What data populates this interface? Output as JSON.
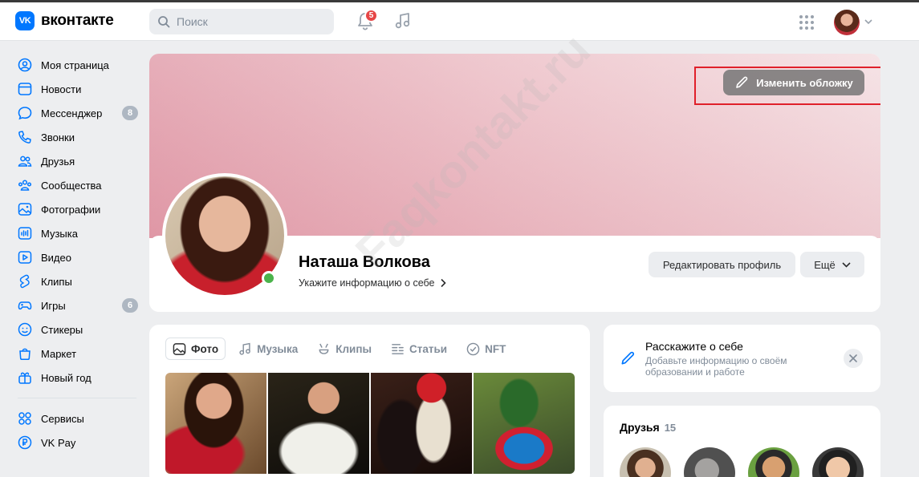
{
  "header": {
    "logo_mark": "VK",
    "logo_text": "вконтакте",
    "search_placeholder": "Поиск",
    "notifications_badge": "5"
  },
  "sidebar": {
    "items": [
      {
        "label": "Моя страница",
        "icon": "user-circle-icon"
      },
      {
        "label": "Новости",
        "icon": "news-icon"
      },
      {
        "label": "Мессенджер",
        "icon": "message-icon",
        "count": "8"
      },
      {
        "label": "Звонки",
        "icon": "phone-icon"
      },
      {
        "label": "Друзья",
        "icon": "friends-icon"
      },
      {
        "label": "Сообщества",
        "icon": "communities-icon"
      },
      {
        "label": "Фотографии",
        "icon": "photo-icon"
      },
      {
        "label": "Музыка",
        "icon": "music-icon"
      },
      {
        "label": "Видео",
        "icon": "video-icon"
      },
      {
        "label": "Клипы",
        "icon": "clips-icon"
      },
      {
        "label": "Игры",
        "icon": "games-icon",
        "count": "6"
      },
      {
        "label": "Стикеры",
        "icon": "stickers-icon"
      },
      {
        "label": "Маркет",
        "icon": "market-icon"
      },
      {
        "label": "Новый год",
        "icon": "gift-icon"
      }
    ],
    "secondary": [
      {
        "label": "Сервисы",
        "icon": "services-icon"
      },
      {
        "label": "VK Pay",
        "icon": "vkpay-icon"
      }
    ]
  },
  "profile": {
    "cover_button": "Изменить обложку",
    "name": "Наташа Волкова",
    "info_link": "Укажите информацию о себе",
    "edit_button": "Редактировать профиль",
    "more_button": "Ещё"
  },
  "media": {
    "tabs": [
      {
        "label": "Фото",
        "icon": "image-icon",
        "active": true
      },
      {
        "label": "Музыка",
        "icon": "music-note-icon"
      },
      {
        "label": "Клипы",
        "icon": "clips-icon"
      },
      {
        "label": "Статьи",
        "icon": "articles-icon"
      },
      {
        "label": "NFT",
        "icon": "nft-icon"
      }
    ]
  },
  "about": {
    "title": "Расскажите о себе",
    "subtitle": "Добавьте информацию о своём образовании и работе"
  },
  "friends": {
    "title": "Друзья",
    "count": "15"
  },
  "watermark": "Faqkontakt.ru",
  "colors": {
    "accent": "#0077ff",
    "badge": "#e64646",
    "highlight": "#e0202a",
    "online": "#4bb34b"
  }
}
